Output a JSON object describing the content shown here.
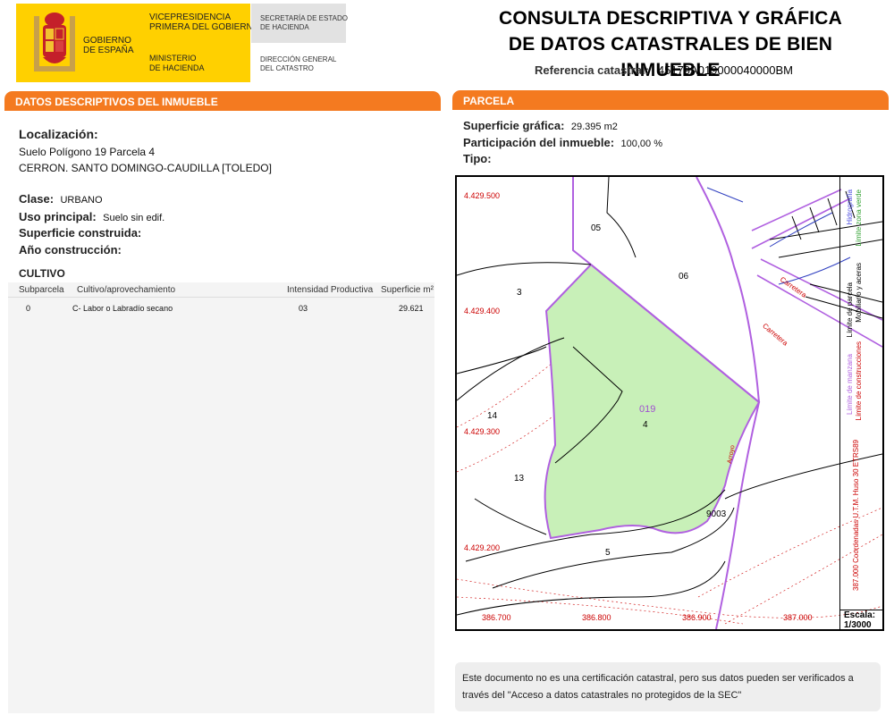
{
  "header": {
    "gobierno": "GOBIERNO\nDE ESPAÑA",
    "vicepresidencia": "VICEPRESIDENCIA\nPRIMERA DEL GOBIERNO",
    "ministerio": "MINISTERIO\nDE HACIENDA",
    "secretaria": "SECRETARÍA DE ESTADO\nDE HACIENDA",
    "direccion": "DIRECCIÓN GENERAL\nDEL CATASTRO",
    "title_line1": "CONSULTA DESCRIPTIVA Y GRÁFICA",
    "title_line2": "DE DATOS CATASTRALES DE BIEN INMUEBLE",
    "ref_label": "Referencia catastral:",
    "ref_value": "45179A019000040000BM"
  },
  "left": {
    "section_title": "DATOS DESCRIPTIVOS DEL INMUEBLE",
    "localizacion_label": "Localización:",
    "localizacion_line1": "Suelo Polígono 19 Parcela 4",
    "localizacion_line2": "CERRON. SANTO DOMINGO-CAUDILLA [TOLEDO]",
    "clase_label": "Clase:",
    "clase_value": "URBANO",
    "uso_label": "Uso principal:",
    "uso_value": "Suelo sin edif.",
    "superficie_label": "Superficie construida:",
    "anio_label": "Año construcción:",
    "cultivo_title": "CULTIVO",
    "columns": [
      "Subparcela",
      "Cultivo/aprovechamiento",
      "Intensidad Productiva",
      "Superficie m²"
    ],
    "rows": [
      {
        "subparcela": "0",
        "cultivo": "C- Labor o Labradío secano",
        "intensidad": "03",
        "superficie": "29.621"
      }
    ]
  },
  "right": {
    "section_title": "PARCELA",
    "sup_grafica_label": "Superficie gráfica:",
    "sup_grafica_value": "29.395 m2",
    "participacion_label": "Participación del inmueble:",
    "participacion_value": "100,00 %",
    "tipo_label": "Tipo:"
  },
  "map": {
    "y_labels": [
      "4.429.500",
      "4.429.400",
      "4.429.300",
      "4.429.200"
    ],
    "x_labels": [
      "386.700",
      "386.800",
      "386.900",
      "387.000"
    ],
    "parcel_ids": [
      "05",
      "06",
      "3",
      "14",
      "13",
      "5",
      "4",
      "9003"
    ],
    "highlight_id": "019",
    "road_label_1": "Carretera",
    "road_label_2": "Carretera",
    "small_label": "Arroyo",
    "legend": {
      "limite_manzana": "Límite de manzana",
      "limite_construcciones": "Límite de construcciones",
      "limite_parcela": "Límite de parcela",
      "mobiliario": "Mobiliario y aceras",
      "hidrografia": "Hidrografía",
      "limite_zona_verde": "Límite zona verde",
      "coordenadas": "387.000 Coordenadas U.T.M. Huso 30 ETRS89"
    },
    "escala_label": "Escala:",
    "escala_value": "1/3000",
    "colors": {
      "parcel_fill": "#c8f0b8",
      "parcel_border": "#b060e0",
      "grid_red": "#cc0000"
    }
  },
  "note": {
    "line1": "Este documento no es una certificación catastral, pero sus datos pueden ser verificados a",
    "line2": "través del \"Acceso a datos catastrales no protegidos de la SEC\""
  }
}
